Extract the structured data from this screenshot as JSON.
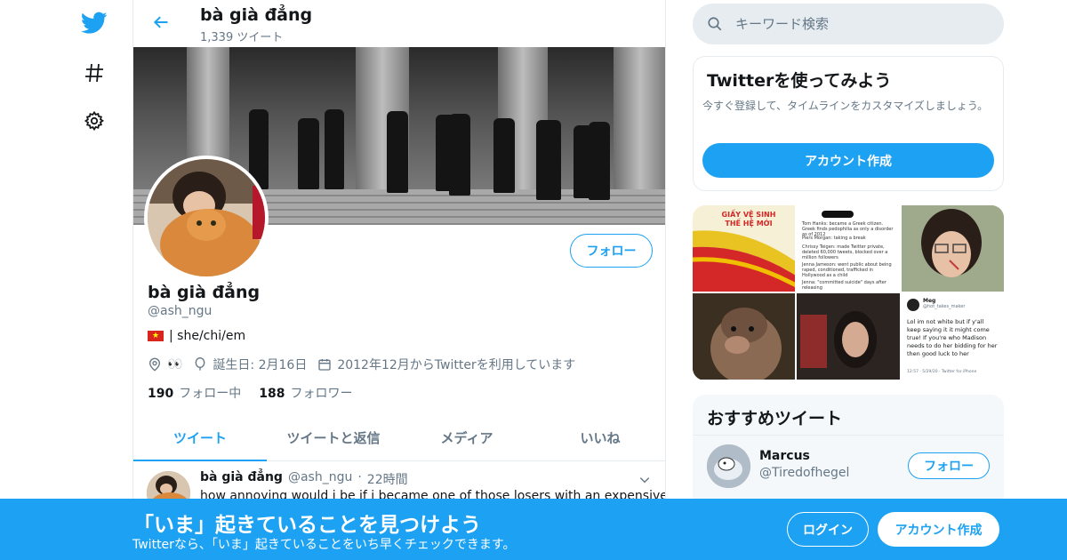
{
  "brand": {
    "accent": "#1da1f2",
    "bottom_bar": "#1da1f2"
  },
  "nav": {
    "icons": [
      "twitter-logo-icon",
      "hashtag-icon",
      "gear-icon"
    ]
  },
  "header": {
    "title": "bà già đẳng",
    "tweet_count": "1,339 ツイート"
  },
  "profile": {
    "name": "bà già đẳng",
    "handle": "@ash_ngu",
    "bio": "| she/chi/em",
    "location": "👀",
    "birthday": "誕生日: 2月16日",
    "joined": "2012年12月からTwitterを利用しています",
    "following_count": "190",
    "following_label": "フォロー中",
    "followers_count": "188",
    "followers_label": "フォロワー",
    "follow_button": "フォロー"
  },
  "tabs": [
    {
      "label": "ツイート",
      "active": true
    },
    {
      "label": "ツイートと返信",
      "active": false
    },
    {
      "label": "メディア",
      "active": false
    },
    {
      "label": "いいね",
      "active": false
    }
  ],
  "tweet": {
    "name": "bà già đẳng",
    "handle": "@ash_ngu",
    "time": "22時間",
    "text": "how annoying would i be if i became one of those losers with an expensive"
  },
  "search": {
    "placeholder": "キーワード検索"
  },
  "signup_card": {
    "title": "Twitterを使ってみよう",
    "text": "今すぐ登録して、タイムラインをカスタマイズしましょう。",
    "button": "アカウント作成"
  },
  "media": {
    "tile1_text": "GIẤY VỆ SINH THẾ HỆ MỚI",
    "tile2_lines": [
      "Tom Hanks: became a Greek citizen. Greek finds pedophilia as only a disorder as of 2012",
      "Piers Morgan: taking a break",
      "Chrissy Teigen: made Twitter private, deleted 60,000 tweets, blocked over a million followers",
      "Jenna Jameson: went public about being raped, conditioned, trafficked in Hollywood as a child",
      "Jenna: \"committed suicide\" days after releasing"
    ],
    "tile6_name": "Meg",
    "tile6_handle": "@hot_takes_maker",
    "tile6_text": "Lol im not white but if y'all keep saying it it might come true! If you're who Madison needs to do her bidding for her then good luck to her",
    "tile6_footer": "12:57 · 5/29/20 · Twitter for iPhone"
  },
  "recommended": {
    "title": "おすすめツイート",
    "user_name": "Marcus",
    "user_handle": "@Tiredofhegel",
    "follow_button": "フォロー"
  },
  "bottom_bar": {
    "title": "「いま」起きていることを見つけよう",
    "subtitle": "Twitterなら、「いま」起きていることをいち早くチェックできます。",
    "login": "ログイン",
    "signup": "アカウント作成"
  }
}
